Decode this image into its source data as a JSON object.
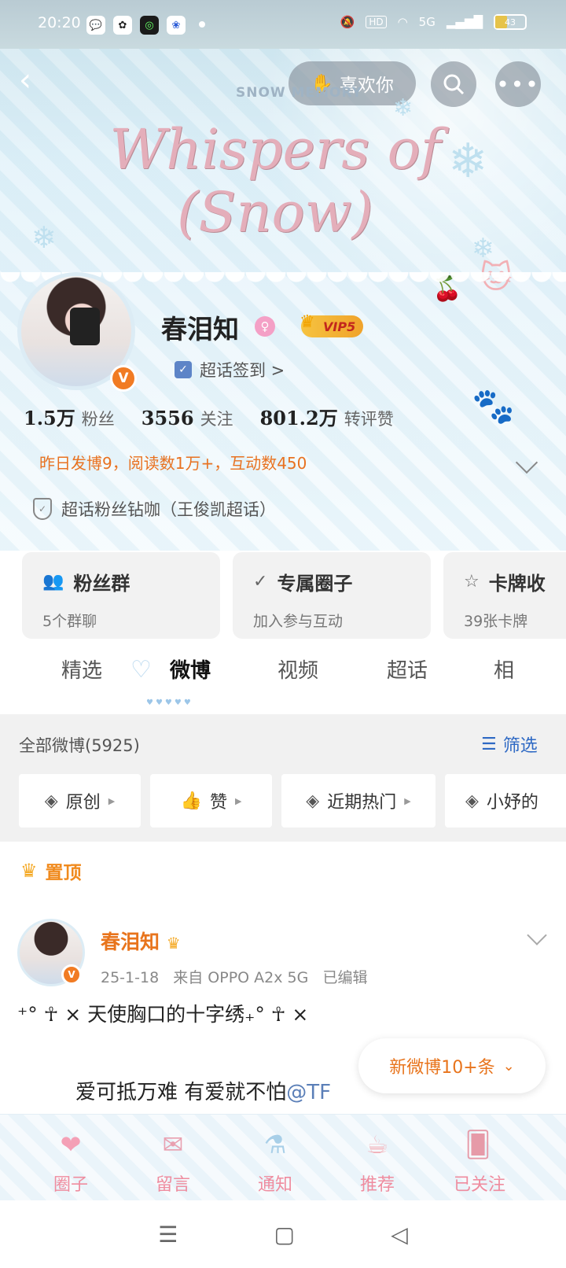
{
  "status_bar": {
    "time": "20:20",
    "network": "5G",
    "hd": "HD",
    "battery": "43"
  },
  "header": {
    "like_label": "喜欢你",
    "banner_title": "Whispers of (Snow)",
    "banner_subtitle": "SNOW MEMORY"
  },
  "profile": {
    "username": "春泪知",
    "vip_label": "VIP5",
    "checkin_label": "超话签到 >",
    "stats": [
      {
        "num": "1.5万",
        "label": "粉丝"
      },
      {
        "num": "3556",
        "label": "关注"
      },
      {
        "num": "801.2万",
        "label": "转评赞"
      }
    ],
    "daily": "昨日发博9，阅读数1万+，互动数450",
    "fan_badge": "超话粉丝钻咖（王俊凯超话）"
  },
  "cards": [
    {
      "title": "粉丝群",
      "sub": "5个群聊",
      "icon": "group-icon"
    },
    {
      "title": "专属圈子",
      "sub": "加入参与互动",
      "icon": "circle-icon"
    },
    {
      "title": "卡牌收",
      "sub": "39张卡牌",
      "icon": "card-icon"
    }
  ],
  "tabs": [
    "精选",
    "微博",
    "视频",
    "超话",
    "相"
  ],
  "feed": {
    "all_label": "全部微博(5925)",
    "filter_label": "筛选",
    "chips": [
      "原创",
      "赞",
      "近期热门",
      "小妤的"
    ]
  },
  "post": {
    "pinned_label": "置顶",
    "author": "春泪知",
    "meta": "25-1-18   来自 OPPO A2x 5G   已编辑",
    "line1": "⁺° ☥ × 天使胸口的十字绣₊° ☥ ×",
    "line2": "爱可抵万难 有爱就不怕",
    "mention": "@TF"
  },
  "new_posts_label": "新微博10+条",
  "bottom_nav": [
    "圈子",
    "留言",
    "通知",
    "推荐",
    "已关注"
  ]
}
